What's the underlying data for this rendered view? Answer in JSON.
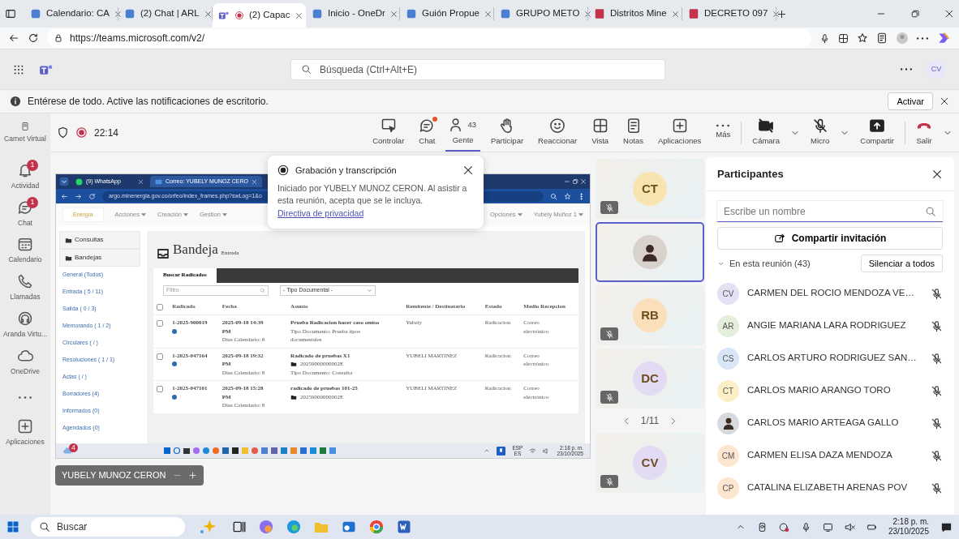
{
  "browser": {
    "tabs": [
      {
        "title": "Calendario: CA",
        "selected": false
      },
      {
        "title": "(2) Chat | ARL",
        "selected": false
      },
      {
        "title": "(2) Capac",
        "selected": true
      },
      {
        "title": "Inicio - OneDr",
        "selected": false
      },
      {
        "title": "Guión Propue",
        "selected": false
      },
      {
        "title": "GRUPO METO",
        "selected": false
      },
      {
        "title": "Distritos Mine",
        "selected": false
      },
      {
        "title": "DECRETO 097",
        "selected": false
      }
    ],
    "url": "https://teams.microsoft.com/v2/"
  },
  "teams_bar": {
    "search_placeholder": "Búsqueda (Ctrl+Alt+E)",
    "avatar": "CV"
  },
  "banner": {
    "text": "Entérese de todo. Active las notificaciones de escritorio.",
    "button": "Activar"
  },
  "rail": [
    {
      "kind": "app",
      "label": "Carnet Virtual"
    },
    {
      "kind": "app",
      "label": "Actividad",
      "badge": "1"
    },
    {
      "kind": "app",
      "label": "Chat",
      "badge": "1"
    },
    {
      "kind": "app",
      "label": "Calendario"
    },
    {
      "kind": "app",
      "label": "Llamadas"
    },
    {
      "kind": "app",
      "label": "Aranda Virtu..."
    },
    {
      "kind": "app",
      "label": "OneDrive"
    },
    {
      "kind": "more"
    },
    {
      "kind": "app",
      "label": "Aplicaciones"
    }
  ],
  "meeting": {
    "recording": true,
    "timer": "22:14",
    "actions": [
      {
        "label": "Controlar",
        "selected": false
      },
      {
        "label": "Chat",
        "selected": false,
        "dot": true
      },
      {
        "label": "Gente",
        "count": "43",
        "selected": true
      },
      {
        "label": "Participar",
        "selected": false
      },
      {
        "label": "Reaccionar",
        "selected": false
      },
      {
        "label": "Vista",
        "selected": false
      },
      {
        "label": "Notas",
        "selected": false
      },
      {
        "label": "Aplicaciones",
        "selected": false
      },
      {
        "label": "Más",
        "selected": false
      }
    ],
    "devices": [
      {
        "kind": "camera",
        "label": "Cámara"
      },
      {
        "kind": "mic",
        "label": "Micro"
      },
      {
        "kind": "share",
        "label": "Compartir"
      },
      {
        "kind": "leave",
        "label": "Salir"
      }
    ]
  },
  "shared_screen": {
    "tabs": [
      {
        "title": "(9) WhatsApp",
        "selected": false
      },
      {
        "title": "Correo: YUBELY MUNOZ CERO",
        "selected": true
      }
    ],
    "url": "argo.minenergia.gov.co/orfeo/index_frames.php?swLog=1&o",
    "logo": "Energía",
    "menus": [
      "Acciones",
      "Creación",
      "Gestion"
    ],
    "user_menus": [
      "Opciones",
      "Yubely Muñoz 1"
    ],
    "sidebar": [
      {
        "kind": "folder",
        "label": "Consultas"
      },
      {
        "kind": "folder",
        "label": "Bandejas"
      },
      {
        "kind": "link",
        "label": "General (Todos)"
      },
      {
        "kind": "link",
        "label": "Entrada ( 5 / 11)"
      },
      {
        "kind": "link",
        "label": "Salida ( 0 / 3)"
      },
      {
        "kind": "link",
        "label": "Memorando ( 1 / 2)"
      },
      {
        "kind": "link",
        "label": "Circulares ( / )"
      },
      {
        "kind": "link",
        "label": "Resoluciones ( 1 / 1)"
      },
      {
        "kind": "link",
        "label": "Actas ( / )"
      },
      {
        "kind": "link",
        "label": "Borradores (4)"
      },
      {
        "kind": "link",
        "label": "Informados (0)"
      },
      {
        "kind": "link",
        "label": "Agendados (0)"
      }
    ],
    "title": "Bandeja",
    "subtitle": "Entrada",
    "tab": "Buscar Radicados",
    "filter_placeholder": "Filtro",
    "select": "- Tipo Documental -",
    "columns": [
      "Radicado",
      "Fecha",
      "Asunto",
      "Remitente / Destinatario",
      "Estado",
      "Medio Recepcion"
    ],
    "header_checked": false,
    "rows": [
      {
        "checked": false,
        "radicado": "1-2025-900019",
        "fecha": "2025-09-18 14:39 PM",
        "dias": "Dias Calendario: 8",
        "asunto": "Prueba Radicacion hacer caso omiso",
        "tipo": "Tipo Documento: Prueba tipos documentales",
        "remitente": "Yubely",
        "estado": "Radicacion",
        "medio": "Correo electrónico"
      },
      {
        "checked": false,
        "radicado": "1-2025-047164",
        "fecha": "2025-09-18 19:32 PM",
        "dias": "Dias Calendario: 8",
        "asunto": "Radicado de pruebas X1",
        "expediente": "20259000000002E",
        "tipo": "Tipo Documento: Consulta",
        "remitente": "YUBELI MARTINEZ",
        "estado": "Radicacion",
        "medio": "Correo electrónico"
      },
      {
        "checked": false,
        "radicado": "1-2025-047101",
        "fecha": "2025-09-18 15:28 PM",
        "dias": "Dias Calendario: 8",
        "asunto": "radicado de pruebas 101-25",
        "expediente": "20259000000002E",
        "remitente": "YUBELI MARTINEZ",
        "estado": "Radicacion",
        "medio": "Correo electrónico"
      }
    ],
    "tray": {
      "badge": "4",
      "lang": "ESP",
      "region": "ES",
      "time": "2:18 p. m.",
      "date": "23/10/2025"
    },
    "presenter": "YUBELY MUNOZ CERON"
  },
  "popup": {
    "title": "Grabación y transcripción",
    "body": "Iniciado por YUBELY MUNOZ CERON. Al asistir a esta reunión, acepta que se le incluya.",
    "link": "Directiva de privacidad"
  },
  "tiles_top": [
    {
      "kind": "initials",
      "initials": "CT",
      "color": "#f8e4b0",
      "muted": true,
      "selected": false
    },
    {
      "kind": "photo",
      "muted": false,
      "selected": true
    },
    {
      "kind": "initials",
      "initials": "RB",
      "color": "#fbdfba",
      "muted": true,
      "selected": false
    },
    {
      "kind": "initials",
      "initials": "DC",
      "color": "#e2dbf3",
      "muted": true,
      "selected": false
    }
  ],
  "pager": "1/11",
  "tiles_bottom": [
    {
      "kind": "initials",
      "initials": "CV",
      "color": "#e2dbf3",
      "muted": true,
      "selected": false
    }
  ],
  "participants": {
    "title": "Participantes",
    "search_placeholder": "Escribe un nombre",
    "invite": "Compartir invitación",
    "section": {
      "label": "En esta reunión (43)",
      "expanded": true
    },
    "mute_all": "Silenciar a todos",
    "people": [
      {
        "kind": "initials",
        "initials": "CV",
        "color": "#e6e0f5",
        "name": "CARMEN DEL ROCIO MENDOZA VE…",
        "muted": true
      },
      {
        "kind": "initials",
        "initials": "AR",
        "color": "#e3eedb",
        "name": "ANGIE MARIANA LARA RODRIGUEZ",
        "muted": true
      },
      {
        "kind": "initials",
        "initials": "CS",
        "color": "#d9e6f5",
        "name": "CARLOS ARTURO RODRIGUEZ SAN…",
        "muted": true
      },
      {
        "kind": "initials",
        "initials": "CT",
        "color": "#fbefc8",
        "name": "CARLOS MARIO ARANGO TORO",
        "muted": true
      },
      {
        "kind": "photo",
        "name": "CARLOS MARIO ARTEAGA GALLO",
        "muted": true
      },
      {
        "kind": "initials",
        "initials": "CM",
        "color": "#fde6cf",
        "name": "CARMEN ELISA DAZA MENDOZA",
        "muted": true
      },
      {
        "kind": "initials",
        "initials": "CP",
        "color": "#fde6cf",
        "name": "CATALINA ELIZABETH ARENAS POV",
        "muted": true
      }
    ]
  },
  "taskbar": {
    "search": "Buscar",
    "time": "2:18 p. m.",
    "date": "23/10/2025"
  }
}
